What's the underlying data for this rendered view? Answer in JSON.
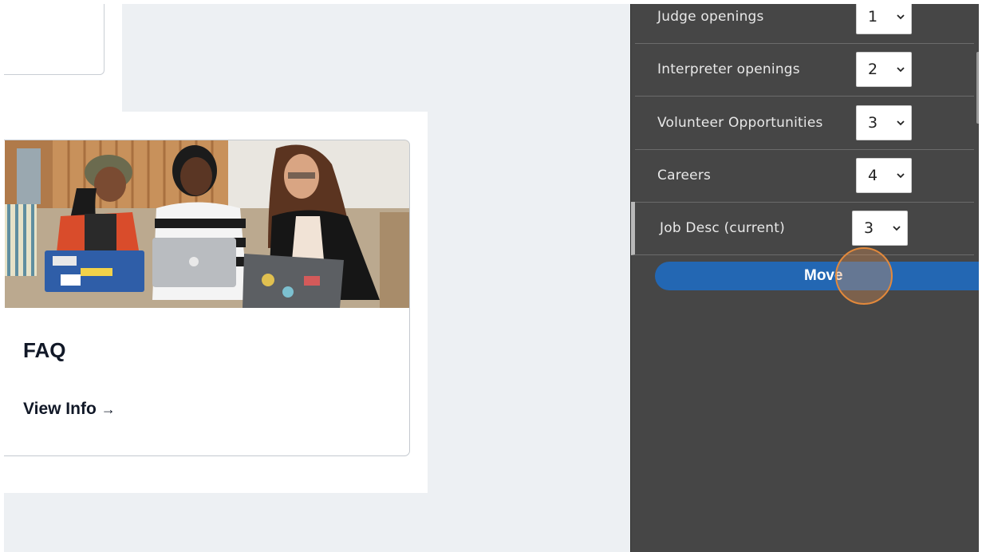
{
  "cards": {
    "faq": {
      "title": "FAQ",
      "link_label": "View Info",
      "link_icon": "arrow-right-icon",
      "link_arrow": "→"
    }
  },
  "sidebar": {
    "items": [
      {
        "label": "Judge openings",
        "value": "1",
        "current": false
      },
      {
        "label": "Interpreter openings",
        "value": "2",
        "current": false
      },
      {
        "label": "Volunteer Opportunities",
        "value": "3",
        "current": false
      },
      {
        "label": "Careers",
        "value": "4",
        "current": false
      },
      {
        "label": "Job Desc (current)",
        "value": "3",
        "current": true
      }
    ],
    "move_label": "Move",
    "colors": {
      "background": "#464646",
      "button": "#2367b3",
      "cursor": "#e3893b"
    }
  }
}
